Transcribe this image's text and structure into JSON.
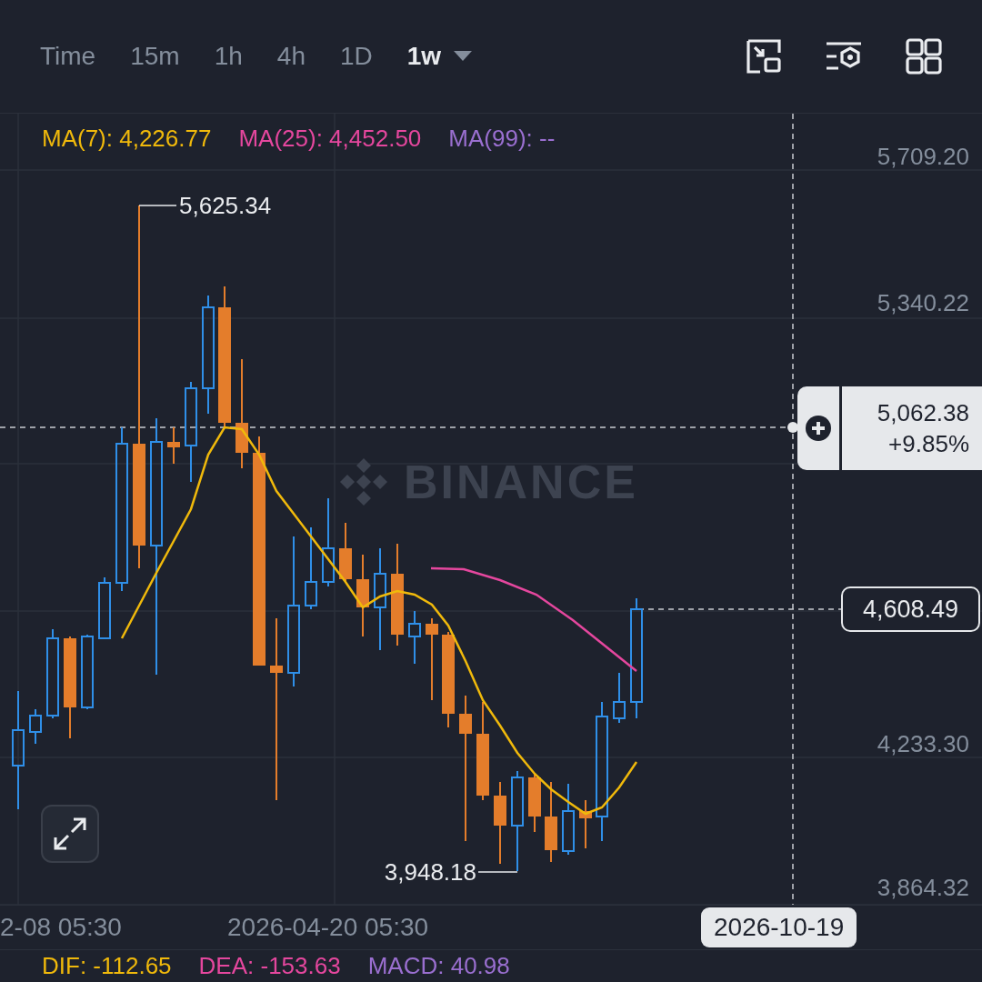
{
  "toolbar": {
    "intervals": [
      {
        "label": "Time",
        "selected": false
      },
      {
        "label": "15m",
        "selected": false
      },
      {
        "label": "1h",
        "selected": false
      },
      {
        "label": "4h",
        "selected": false
      },
      {
        "label": "1D",
        "selected": false
      },
      {
        "label": "1w",
        "selected": true
      }
    ]
  },
  "legend": [
    {
      "label": "MA(7): 4,226.77",
      "color": "#f0b90b"
    },
    {
      "label": "MA(25): 4,452.50",
      "color": "#e5479e"
    },
    {
      "label": "MA(99): --",
      "color": "#9a6fd0"
    }
  ],
  "price_axis": [
    "5,709.20",
    "5,340.22",
    "4,233.30",
    "3,864.32"
  ],
  "chart_brand": "BINANCE",
  "high_label": "5,625.34",
  "low_label": "3,948.18",
  "crosshair": {
    "price": "5,062.38",
    "change": "+9.85%",
    "date": "2026-10-19"
  },
  "last_price": "4,608.49",
  "time_axis": [
    "2-08 05:30",
    "2026-04-20 05:30"
  ],
  "indicators": [
    {
      "label": "DIF: -112.65",
      "color": "#f0b90b"
    },
    {
      "label": "DEA: -153.63",
      "color": "#e5479e"
    },
    {
      "label": "MACD: 40.98",
      "color": "#9a6fd0"
    }
  ]
}
